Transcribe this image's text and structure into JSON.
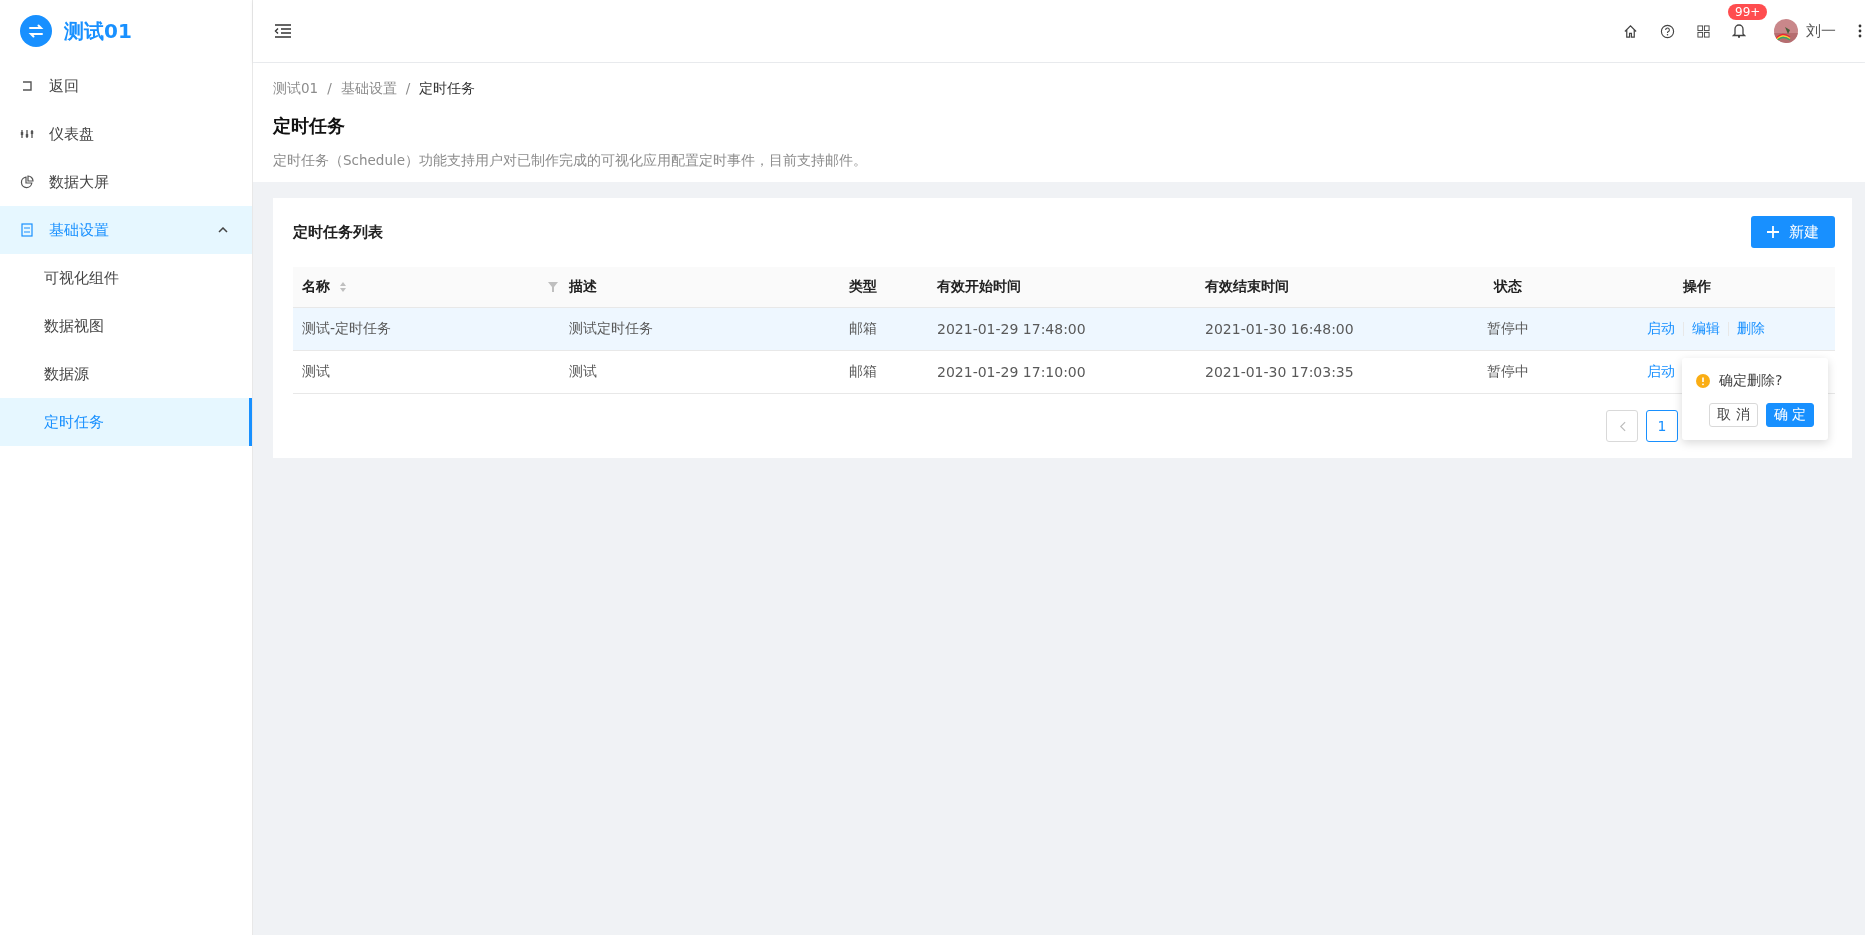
{
  "sidebar": {
    "logo": "测试01",
    "items": [
      {
        "label": "返回",
        "kind": "item",
        "selected": false
      },
      {
        "label": "仪表盘",
        "kind": "item",
        "selected": false
      },
      {
        "label": "数据大屏",
        "kind": "item",
        "selected": false
      },
      {
        "label": "基础设置",
        "kind": "group",
        "selected": true,
        "expanded": true,
        "children": [
          {
            "label": "可视化组件",
            "selected": false
          },
          {
            "label": "数据视图",
            "selected": false
          },
          {
            "label": "数据源",
            "selected": false
          },
          {
            "label": "定时任务",
            "selected": true
          }
        ]
      }
    ]
  },
  "header": {
    "notification_badge": "99+",
    "user": "刘一"
  },
  "breadcrumb": {
    "separator": "/",
    "items": [
      "测试01",
      "基础设置",
      "定时任务"
    ]
  },
  "page": {
    "title": "定时任务",
    "description": "定时任务（Schedule）功能支持用户对已制作完成的可视化应用配置定时事件，目前支持邮件。"
  },
  "card": {
    "title": "定时任务列表",
    "new_button": "新建"
  },
  "table": {
    "columns": [
      "名称",
      "描述",
      "类型",
      "有效开始时间",
      "有效结束时间",
      "状态",
      "操作"
    ],
    "rows": [
      {
        "cells": [
          "测试-定时任务",
          "测试定时任务",
          "邮箱",
          "2021-01-29 17:48:00",
          "2021-01-30 16:48:00",
          "暂停中"
        ],
        "actions": [
          "启动",
          "编辑",
          "删除"
        ],
        "highlighted": true
      },
      {
        "cells": [
          "测试",
          "测试",
          "邮箱",
          "2021-01-29 17:10:00",
          "2021-01-30 17:03:35",
          "暂停中"
        ],
        "actions": [
          "启动"
        ],
        "highlighted": false
      }
    ]
  },
  "pagination": {
    "pages": [
      {
        "label": "1",
        "selected": true
      }
    ]
  },
  "popconfirm": {
    "message": "确定删除?",
    "cancel": "取 消",
    "ok": "确 定"
  }
}
